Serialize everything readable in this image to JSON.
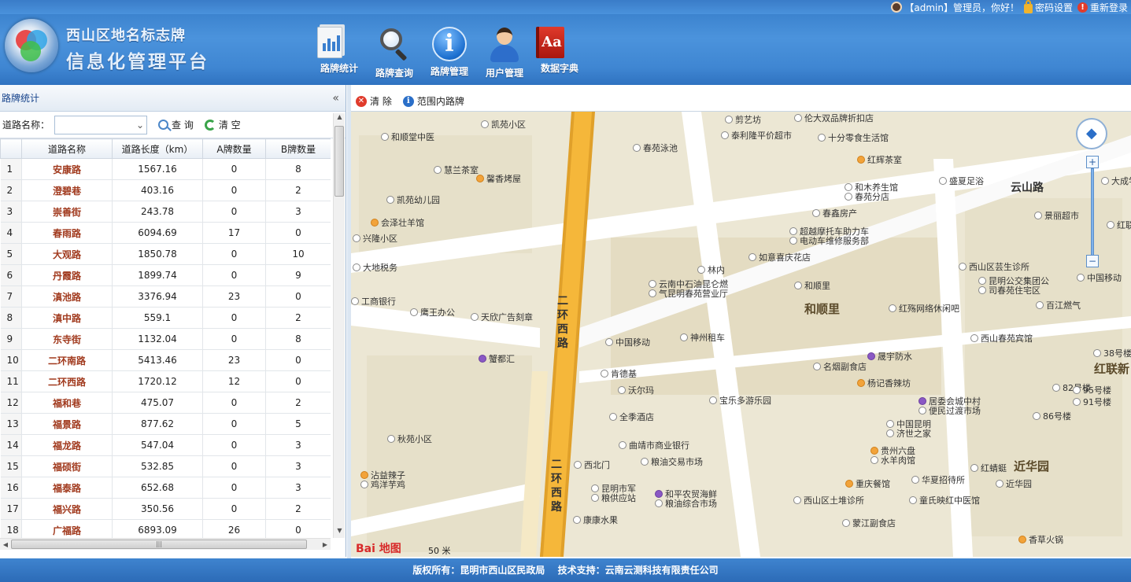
{
  "app": {
    "title_line1": "西山区地名标志牌",
    "title_line2": "信息化管理平台"
  },
  "topbar": {
    "user_text": "【admin】管理员，你好！",
    "password_label": "密码设置",
    "relogin_label": "重新登录"
  },
  "nav": [
    {
      "label": "路牌统计",
      "icon": "stats-icon"
    },
    {
      "label": "路牌查询",
      "icon": "search-icon"
    },
    {
      "label": "路牌管理",
      "icon": "info-icon"
    },
    {
      "label": "用户管理",
      "icon": "user-icon"
    },
    {
      "label": "数据字典",
      "icon": "dictionary-icon"
    }
  ],
  "left_panel": {
    "title": "路牌统计",
    "collapse_glyph": "«",
    "filter_label": "道路名称：",
    "select_value": "",
    "query_label": "查 询",
    "clear_label": "清 空"
  },
  "table": {
    "columns": [
      "",
      "道路名称",
      "道路长度（km）",
      "A牌数量",
      "B牌数量"
    ],
    "rows": [
      [
        "1",
        "安康路",
        "1567.16",
        "0",
        "8"
      ],
      [
        "2",
        "澄碧巷",
        "403.16",
        "0",
        "2"
      ],
      [
        "3",
        "崇善街",
        "243.78",
        "0",
        "3"
      ],
      [
        "4",
        "春雨路",
        "6094.69",
        "17",
        "0"
      ],
      [
        "5",
        "大观路",
        "1850.78",
        "0",
        "10"
      ],
      [
        "6",
        "丹霞路",
        "1899.74",
        "0",
        "9"
      ],
      [
        "7",
        "滇池路",
        "3376.94",
        "23",
        "0"
      ],
      [
        "8",
        "滇中路",
        "559.1",
        "0",
        "2"
      ],
      [
        "9",
        "东寺街",
        "1132.04",
        "0",
        "8"
      ],
      [
        "10",
        "二环南路",
        "5413.46",
        "23",
        "0"
      ],
      [
        "11",
        "二环西路",
        "1720.12",
        "12",
        "0"
      ],
      [
        "12",
        "福和巷",
        "475.07",
        "0",
        "2"
      ],
      [
        "13",
        "福景路",
        "877.62",
        "0",
        "5"
      ],
      [
        "14",
        "福龙路",
        "547.04",
        "0",
        "3"
      ],
      [
        "15",
        "福硕街",
        "532.85",
        "0",
        "3"
      ],
      [
        "16",
        "福泰路",
        "652.68",
        "0",
        "3"
      ],
      [
        "17",
        "福兴路",
        "350.56",
        "0",
        "2"
      ],
      [
        "18",
        "广福路",
        "6893.09",
        "26",
        "0"
      ]
    ]
  },
  "map_toolbar": {
    "clear_label": "清 除",
    "range_label": "范围内路牌"
  },
  "map": {
    "areas": [
      "和顺里",
      "近华园",
      "红联新"
    ],
    "roads": [
      "云山路",
      "二环西路",
      "二环西路"
    ],
    "pois": [
      "凯苑小区",
      "和顺堂中医",
      "剪艺坊",
      "伦大双品牌折扣店",
      "泰利隆平价超市",
      "十分零食生活馆",
      "春苑泳池",
      "慧兰茶室",
      "馨香烤屋",
      "红辉茶室",
      "和木养生馆",
      "春苑分店",
      "盛夏足浴",
      "凯苑幼儿园",
      "春鑫房产",
      "会泽壮羊馆",
      "景丽超市",
      "红联",
      "兴隆小区",
      "超越摩托车助力车",
      "电动车维修服务部",
      "大成学校",
      "如意喜庆花店",
      "大地税务",
      "林内",
      "西山区芸生诊所",
      "云南中石油昆仑燃",
      "气昆明春苑营业厅",
      "和顺里",
      "昆明公交集团公",
      "司春苑住宅区",
      "中国移动",
      "工商银行",
      "百江燃气",
      "红殇网络休闲吧",
      "鹰王办公",
      "天欣广告刻章",
      "中国移动",
      "神州租车",
      "西山春苑宾馆",
      "晟宇防水",
      "蟹都汇",
      "名烟副食店",
      "38号楼",
      "肯德基",
      "杨记香辣坊",
      "82号楼",
      "95号楼",
      "沃尔玛",
      "宝乐多游乐园",
      "居委会城中村",
      "便民过渡市场",
      "91号楼",
      "全季酒店",
      "中国昆明",
      "济世之家",
      "86号楼",
      "秋苑小区",
      "曲靖市商业银行",
      "贵州六盘",
      "水羊肉馆",
      "红蜻蜓",
      "粮油交易市场",
      "华夏招待所",
      "沾益辣子",
      "鸡洋芋鸡",
      "西北门",
      "重庆餐馆",
      "近华园",
      "昆明市军",
      "粮供应站",
      "和平农贸海鲜",
      "粮油综合市场",
      "西山区土堆诊所",
      "童氏映红中医馆",
      "康康水果",
      "蒙江副食店",
      "香草火锅"
    ],
    "scale_text": "50 米",
    "brand": "Bai 地图"
  },
  "footer": {
    "text": "版权所有：昆明市西山区民政局　 技术支持：云南云测科技有限责任公司"
  }
}
